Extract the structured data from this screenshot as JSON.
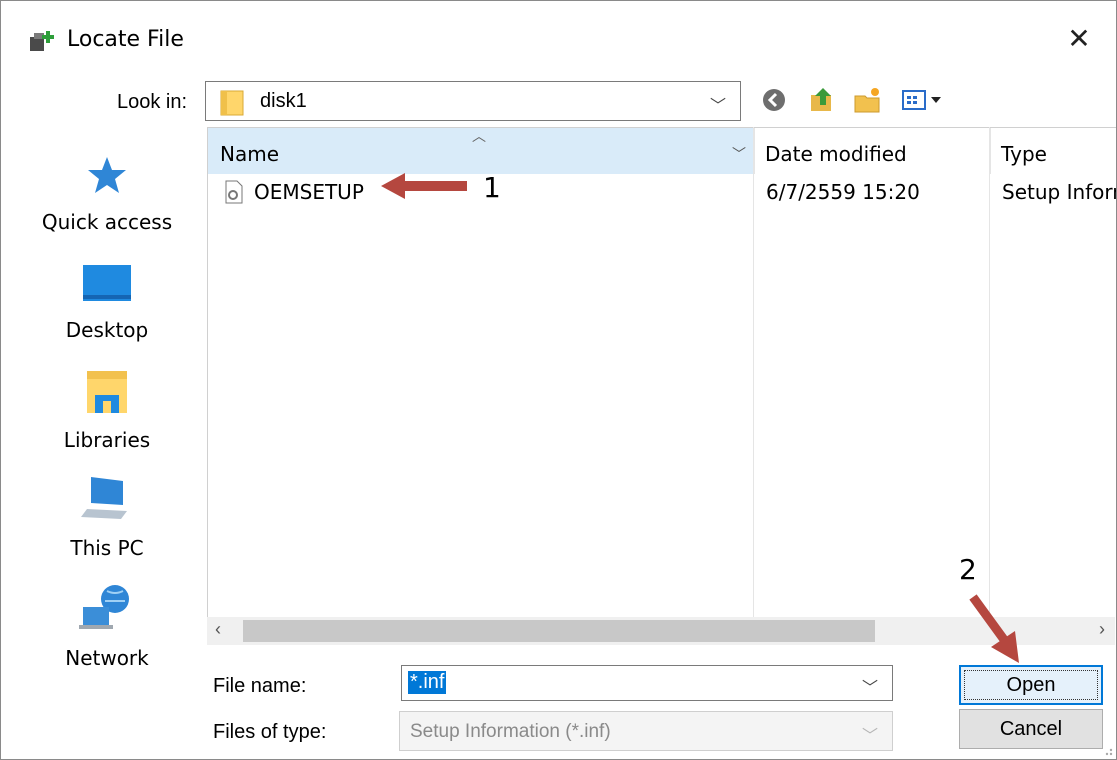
{
  "window": {
    "title": "Locate File",
    "close_glyph": "✕"
  },
  "toolbar": {
    "look_in_label": "Look in:",
    "look_in_value": "disk1",
    "buttons": [
      "back-icon",
      "up-folder-icon",
      "new-folder-icon",
      "view-menu-icon"
    ]
  },
  "places": [
    {
      "label": "Quick access",
      "icon": "star-icon"
    },
    {
      "label": "Desktop",
      "icon": "desktop-icon"
    },
    {
      "label": "Libraries",
      "icon": "libraries-icon"
    },
    {
      "label": "This PC",
      "icon": "computer-icon"
    },
    {
      "label": "Network",
      "icon": "network-icon"
    }
  ],
  "file_list": {
    "columns": [
      "Name",
      "Date modified",
      "Type"
    ],
    "rows": [
      {
        "name": "OEMSETUP",
        "date": "6/7/2559 15:20",
        "type": "Setup Information"
      }
    ]
  },
  "footer": {
    "file_name_label": "File name:",
    "file_name_value": "*.inf",
    "file_type_label": "Files of type:",
    "file_type_value": "Setup Information (*.inf)",
    "open_label": "Open",
    "cancel_label": "Cancel"
  },
  "annotations": {
    "step1": "1",
    "step2": "2",
    "arrow_color": "#b5473f"
  }
}
